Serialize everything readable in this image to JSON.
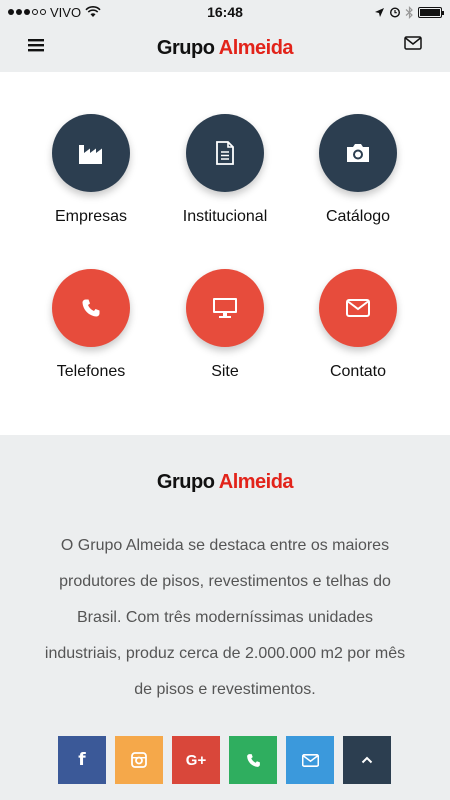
{
  "status": {
    "carrier": "VIVO",
    "time": "16:48"
  },
  "header": {
    "logo_part1": "Grupo",
    "logo_part2": "Almeida"
  },
  "grid": [
    {
      "label": "Empresas",
      "icon": "factory-icon",
      "color": "#2c3e50"
    },
    {
      "label": "Institucional",
      "icon": "document-icon",
      "color": "#2c3e50"
    },
    {
      "label": "Catálogo",
      "icon": "camera-icon",
      "color": "#2c3e50"
    },
    {
      "label": "Telefones",
      "icon": "phone-icon",
      "color": "#e74c3c"
    },
    {
      "label": "Site",
      "icon": "monitor-icon",
      "color": "#e74c3c"
    },
    {
      "label": "Contato",
      "icon": "envelope-icon",
      "color": "#e74c3c"
    }
  ],
  "about": {
    "logo_part1": "Grupo",
    "logo_part2": "Almeida",
    "text": "O Grupo Almeida se destaca entre os maiores produtores de pisos, revestimentos e telhas do Brasil. Com três moderníssimas unidades industriais, produz cerca de 2.000.000 m2 por mês de pisos e revestimentos."
  },
  "social": [
    {
      "name": "facebook",
      "icon": "facebook-icon",
      "glyph": "f",
      "color": "#3b5998"
    },
    {
      "name": "instagram",
      "icon": "instagram-icon",
      "color": "#f5a84a"
    },
    {
      "name": "google-plus",
      "icon": "google-plus-icon",
      "glyph": "G+",
      "color": "#d9473a"
    },
    {
      "name": "phone",
      "icon": "phone-icon",
      "color": "#2fae5f"
    },
    {
      "name": "email",
      "icon": "envelope-icon",
      "color": "#3b99dc"
    },
    {
      "name": "back-to-top",
      "icon": "chevron-up-icon",
      "color": "#2c3e50"
    }
  ]
}
